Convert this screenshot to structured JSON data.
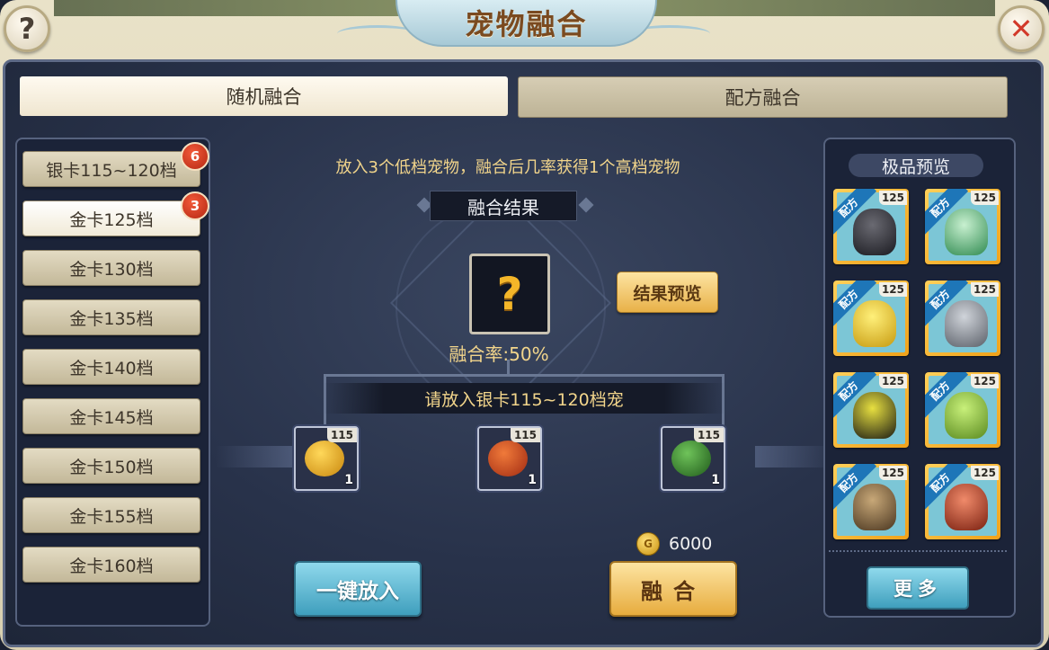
{
  "header": {
    "title": "宠物融合",
    "help_icon": "question-icon",
    "close_icon": "close-x-icon"
  },
  "tabs": [
    {
      "label": "随机融合",
      "active": true
    },
    {
      "label": "配方融合",
      "active": false
    }
  ],
  "tiers": [
    {
      "label": "银卡115~120档",
      "badge": "6",
      "active": false
    },
    {
      "label": "金卡125档",
      "badge": "3",
      "active": true
    },
    {
      "label": "金卡130档",
      "badge": "",
      "active": false
    },
    {
      "label": "金卡135档",
      "badge": "",
      "active": false
    },
    {
      "label": "金卡140档",
      "badge": "",
      "active": false
    },
    {
      "label": "金卡145档",
      "badge": "",
      "active": false
    },
    {
      "label": "金卡150档",
      "badge": "",
      "active": false
    },
    {
      "label": "金卡155档",
      "badge": "",
      "active": false
    },
    {
      "label": "金卡160档",
      "badge": "",
      "active": false
    }
  ],
  "fusion": {
    "instruction": "放入3个低档宠物，融合后几率获得1个高档宠物",
    "result_label": "融合结果",
    "result_placeholder": "?",
    "preview_button": "结果预览",
    "rate": "融合率:50%",
    "slot_prompt": "请放入银卡115~120档宠",
    "slots": [
      {
        "level": "115",
        "count": "1",
        "color": "#e8b21f"
      },
      {
        "level": "115",
        "count": "1",
        "color": "#d4542a"
      },
      {
        "level": "115",
        "count": "1",
        "color": "#3f8f3a"
      }
    ],
    "cost": "6000",
    "one_key_button": "一键放入",
    "fuse_button": "融合"
  },
  "preview": {
    "title": "极品预览",
    "cards": [
      {
        "ribbon": "配方",
        "level": "125",
        "color": "#3a3a40"
      },
      {
        "ribbon": "配方",
        "level": "125",
        "color": "#3aa060"
      },
      {
        "ribbon": "配方",
        "level": "125",
        "color": "#e8c02a"
      },
      {
        "ribbon": "配方",
        "level": "125",
        "color": "#8a8f9a"
      },
      {
        "ribbon": "配方",
        "level": "125",
        "color": "#2a2a22"
      },
      {
        "ribbon": "配方",
        "level": "125",
        "color": "#8ec33f"
      },
      {
        "ribbon": "配方",
        "level": "125",
        "color": "#7a6040"
      },
      {
        "ribbon": "配方",
        "level": "125",
        "color": "#c0452a"
      }
    ],
    "more_button": "更多"
  }
}
